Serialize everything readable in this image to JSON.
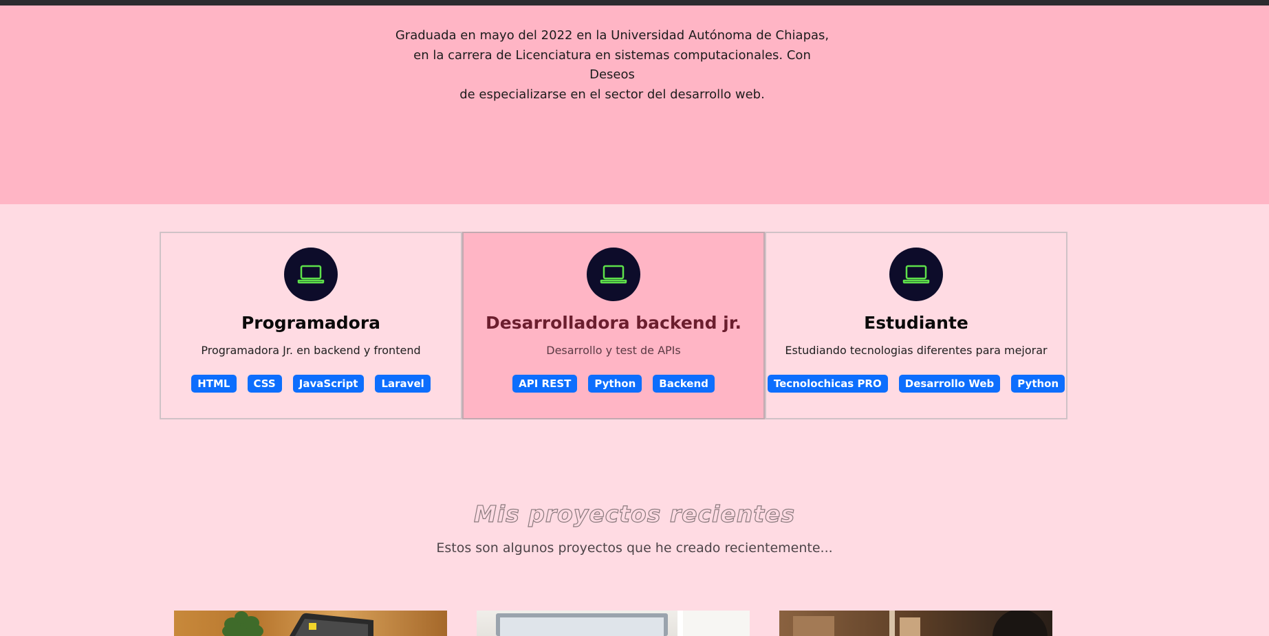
{
  "hero": {
    "description_lines": [
      "Graduada en mayo del 2022 en la Universidad Autónoma de Chiapas,",
      "en la carrera de Licenciatura en sistemas computacionales. Con Deseos",
      "de especializarse en el sector del desarrollo web."
    ]
  },
  "cards": [
    {
      "icon": "laptop-icon",
      "title": "Programadora",
      "description": "Programadora Jr. en backend y frontend",
      "tags": [
        "HTML",
        "CSS",
        "JavaScript",
        "Laravel"
      ]
    },
    {
      "icon": "laptop-icon",
      "title": "Desarrolladora backend jr.",
      "description": "Desarrollo y test de APIs",
      "tags": [
        "API REST",
        "Python",
        "Backend"
      ]
    },
    {
      "icon": "laptop-icon",
      "title": "Estudiante",
      "description": "Estudiando tecnologias diferentes para mejorar",
      "tags": [
        "Tecnolochicas PRO",
        "Desarrollo Web",
        "Python"
      ]
    }
  ],
  "projects": {
    "title": "Mis proyectos recientes",
    "subtitle": "Estos son algunos proyectos que he creado recientemente..."
  },
  "colors": {
    "hero_bg": "#ffb5c5",
    "page_bg": "#ffdbe3",
    "icon_circle": "#0d0c2a",
    "icon_stroke": "#5ee14a",
    "tag_bg": "#0d6efd"
  }
}
